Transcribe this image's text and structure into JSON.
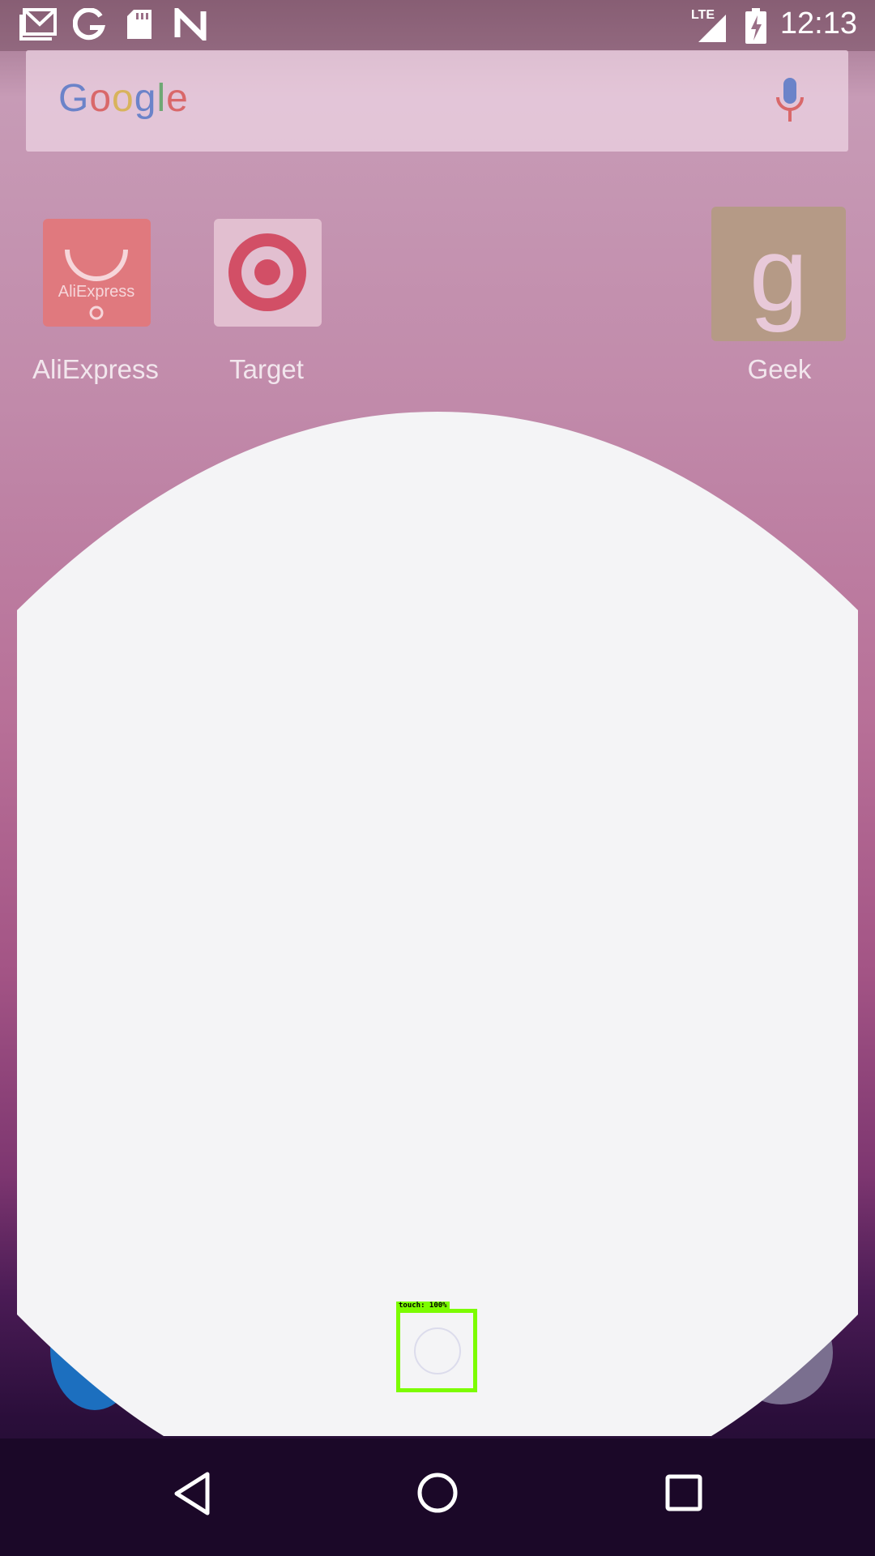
{
  "status_bar": {
    "time": "12:13",
    "network_label": "LTE",
    "left_icons": [
      "gmail-icon",
      "google-icon",
      "sd-card-icon",
      "n-icon"
    ],
    "right_icons": [
      "lte-signal-icon",
      "battery-charging-icon"
    ]
  },
  "search_bar": {
    "logo_letters": [
      {
        "ch": "G",
        "color": "#6b83c9"
      },
      {
        "ch": "o",
        "color": "#d9686a"
      },
      {
        "ch": "o",
        "color": "#d8b35c"
      },
      {
        "ch": "g",
        "color": "#6b83c9"
      },
      {
        "ch": "l",
        "color": "#6fa874"
      },
      {
        "ch": "e",
        "color": "#d9686a"
      }
    ],
    "mic_icon": "mic-icon"
  },
  "apps": [
    {
      "label": "AliExpress",
      "icon": "aliexpress-icon",
      "icon_text": "AliExpress"
    },
    {
      "label": "Target",
      "icon": "target-icon"
    },
    {
      "label": "Geek",
      "icon": "geek-icon",
      "icon_text": "g"
    }
  ],
  "overlay": {
    "detection_label": "touch: 100%"
  },
  "nav_bar": {
    "buttons": [
      "back-icon",
      "home-icon",
      "recents-icon"
    ]
  },
  "colors": {
    "sheet": "#f4f4f6",
    "detection": "#7cfc00",
    "nav_bar": "#1b0828"
  }
}
